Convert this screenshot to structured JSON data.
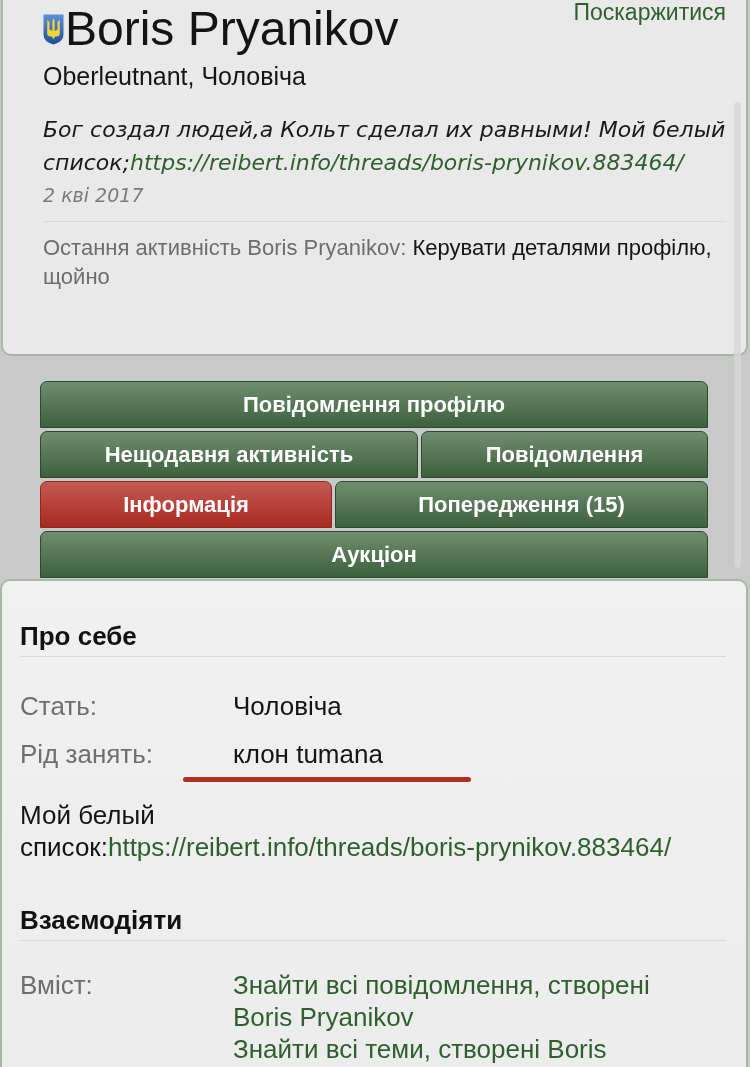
{
  "profile": {
    "name": "Boris Pryanikov",
    "report_link": "Поскаржитися",
    "subtitle": "Oberleutnant, Чоловіча",
    "status": {
      "text": "Бог создал людей,а Кольт сделал их равными! Мой белый список;",
      "link": "https://reibert.info/threads/boris-prynikov.883464/",
      "date": "2 кві 2017"
    },
    "last_activity": {
      "label": "Остання активність Boris Pryanikov:",
      "action": "Керувати деталями профілю,",
      "time": "щойно"
    }
  },
  "tab_rows": [
    {
      "tabs": [
        {
          "label": "Повідомлення профілю",
          "selected": false
        }
      ]
    },
    {
      "tabs": [
        {
          "label": "Нещодавня активність",
          "selected": false
        },
        {
          "label": "Повідомлення",
          "selected": false
        }
      ]
    },
    {
      "tabs": [
        {
          "label": "Інформація",
          "selected": true
        },
        {
          "label": "Попередження (15)",
          "selected": false
        }
      ]
    },
    {
      "tabs": [
        {
          "label": "Аукціон",
          "selected": false
        }
      ]
    }
  ],
  "about": {
    "title": "Про себе",
    "fields": [
      {
        "label": "Стать:",
        "value": "Чоловіча",
        "underlined": false
      },
      {
        "label": "Рід занять:",
        "value": "клон tumana",
        "underlined": true
      }
    ],
    "note": {
      "text": "Мой белый список:",
      "link": "https://reibert.info/threads/boris-prynikov.883464/"
    }
  },
  "interact": {
    "title": "Взаємодіяти",
    "rows": [
      {
        "label": "Вміст:",
        "links": [
          "Знайти всі повідомлення, створені Boris Pryanikov",
          "Знайти всі теми, створені Boris"
        ]
      }
    ]
  }
}
